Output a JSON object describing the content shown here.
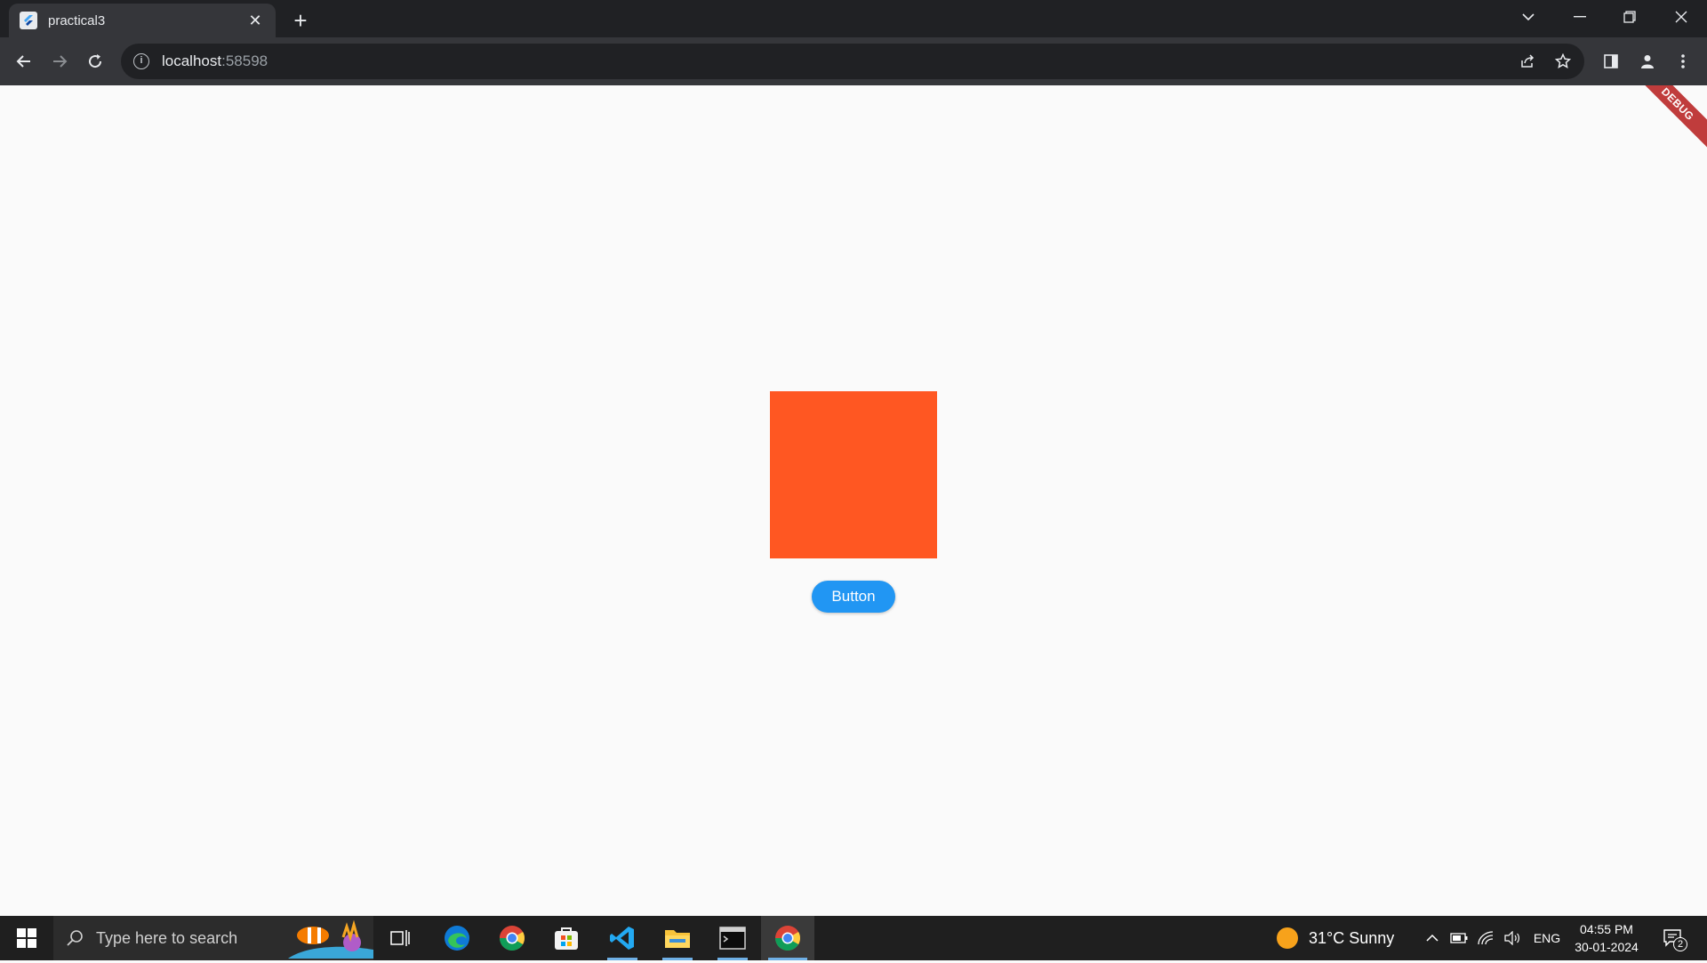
{
  "browser": {
    "tab_title": "practical3",
    "tab_close": "✕",
    "new_tab": "+",
    "url_host": "localhost",
    "url_port": ":58598"
  },
  "app": {
    "button_label": "Button",
    "debug_banner": "DEBUG",
    "box_color": "#ff5722",
    "button_color": "#2196f3"
  },
  "taskbar": {
    "search_placeholder": "Type here to search",
    "weather": "31°C  Sunny",
    "language": "ENG",
    "time": "04:55 PM",
    "date": "30-01-2024",
    "notification_count": "2"
  }
}
